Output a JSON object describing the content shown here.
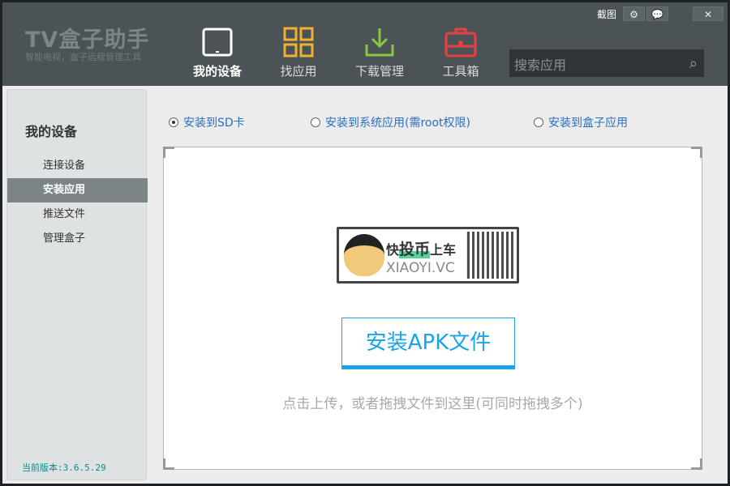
{
  "app": {
    "logo": "TV盒子助手",
    "slogan": "智能电视，盒子远程管理工具"
  },
  "nav": [
    {
      "label": "我的设备",
      "icon": "tv-icon"
    },
    {
      "label": "找应用",
      "icon": "apps-grid-icon"
    },
    {
      "label": "下载管理",
      "icon": "download-icon"
    },
    {
      "label": "工具箱",
      "icon": "toolbox-icon"
    }
  ],
  "toolbar": {
    "screenshot": "截图",
    "settings": "⚙",
    "feedback": "💬",
    "close": "✕"
  },
  "search": {
    "placeholder": "搜索应用"
  },
  "sidebar": {
    "title": "我的设备",
    "items": [
      "连接设备",
      "安装应用",
      "推送文件",
      "管理盒子"
    ],
    "version": "当前版本:3.6.5.29"
  },
  "options": [
    "安装到SD卡",
    "安装到系统应用(需root权限)",
    "安装到盒子应用"
  ],
  "banner": {
    "fast": "快",
    "coin": "投币",
    "car": "上车",
    "site": "XIAOYI.VC"
  },
  "main": {
    "install_button": "安装APK文件",
    "hint": "点击上传，或者拖拽文件到这里(可同时拖拽多个)"
  }
}
